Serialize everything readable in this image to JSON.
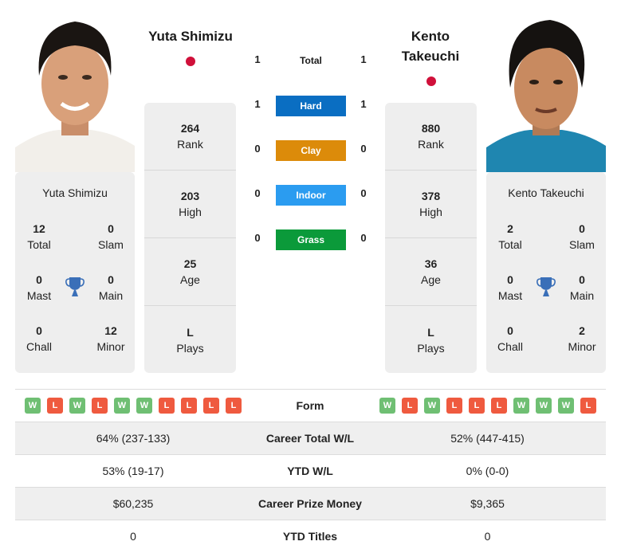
{
  "player1": {
    "name": "Yuta Shimizu",
    "flag_color": "#d0103a",
    "photo_alt": "Yuta Shimizu photo",
    "titles": {
      "total": {
        "value": "12",
        "label": "Total"
      },
      "slam": {
        "value": "0",
        "label": "Slam"
      },
      "mast": {
        "value": "0",
        "label": "Mast"
      },
      "main": {
        "value": "0",
        "label": "Main"
      },
      "chall": {
        "value": "0",
        "label": "Chall"
      },
      "minor": {
        "value": "12",
        "label": "Minor"
      }
    },
    "rank": {
      "value": "264",
      "label": "Rank"
    },
    "high": {
      "value": "203",
      "label": "High"
    },
    "age": {
      "value": "25",
      "label": "Age"
    },
    "plays": {
      "value": "L",
      "label": "Plays"
    },
    "form": [
      "W",
      "L",
      "W",
      "L",
      "W",
      "W",
      "L",
      "L",
      "L",
      "L"
    ]
  },
  "player2": {
    "name": "Kento Takeuchi",
    "name_line1": "Kento",
    "name_line2": "Takeuchi",
    "flag_color": "#d0103a",
    "photo_alt": "Kento Takeuchi photo",
    "titles": {
      "total": {
        "value": "2",
        "label": "Total"
      },
      "slam": {
        "value": "0",
        "label": "Slam"
      },
      "mast": {
        "value": "0",
        "label": "Mast"
      },
      "main": {
        "value": "0",
        "label": "Main"
      },
      "chall": {
        "value": "0",
        "label": "Chall"
      },
      "minor": {
        "value": "2",
        "label": "Minor"
      }
    },
    "rank": {
      "value": "880",
      "label": "Rank"
    },
    "high": {
      "value": "378",
      "label": "High"
    },
    "age": {
      "value": "36",
      "label": "Age"
    },
    "plays": {
      "value": "L",
      "label": "Plays"
    },
    "form": [
      "W",
      "L",
      "W",
      "L",
      "L",
      "L",
      "W",
      "W",
      "W",
      "L"
    ]
  },
  "h2h": {
    "total": {
      "label": "Total",
      "p1": "1",
      "p2": "1"
    },
    "surfaces": [
      {
        "label": "Hard",
        "p1": "1",
        "p2": "1",
        "color": "#0a6ec2"
      },
      {
        "label": "Clay",
        "p1": "0",
        "p2": "0",
        "color": "#dc8b0a"
      },
      {
        "label": "Indoor",
        "p1": "0",
        "p2": "0",
        "color": "#2b9cf0"
      },
      {
        "label": "Grass",
        "p1": "0",
        "p2": "0",
        "color": "#0b9a3a"
      }
    ]
  },
  "comparison": {
    "form_label": "Form",
    "rows": [
      {
        "label": "Career Total W/L",
        "p1": "64% (237-133)",
        "p2": "52% (447-415)"
      },
      {
        "label": "YTD W/L",
        "p1": "53% (19-17)",
        "p2": "0% (0-0)"
      },
      {
        "label": "Career Prize Money",
        "p1": "$60,235",
        "p2": "$9,365"
      },
      {
        "label": "YTD Titles",
        "p1": "0",
        "p2": "0"
      }
    ]
  },
  "colors": {
    "win": "#6fbf73",
    "loss": "#ef5a3f",
    "trophy": "#3a6fb8",
    "card_bg": "#eeeeee"
  }
}
